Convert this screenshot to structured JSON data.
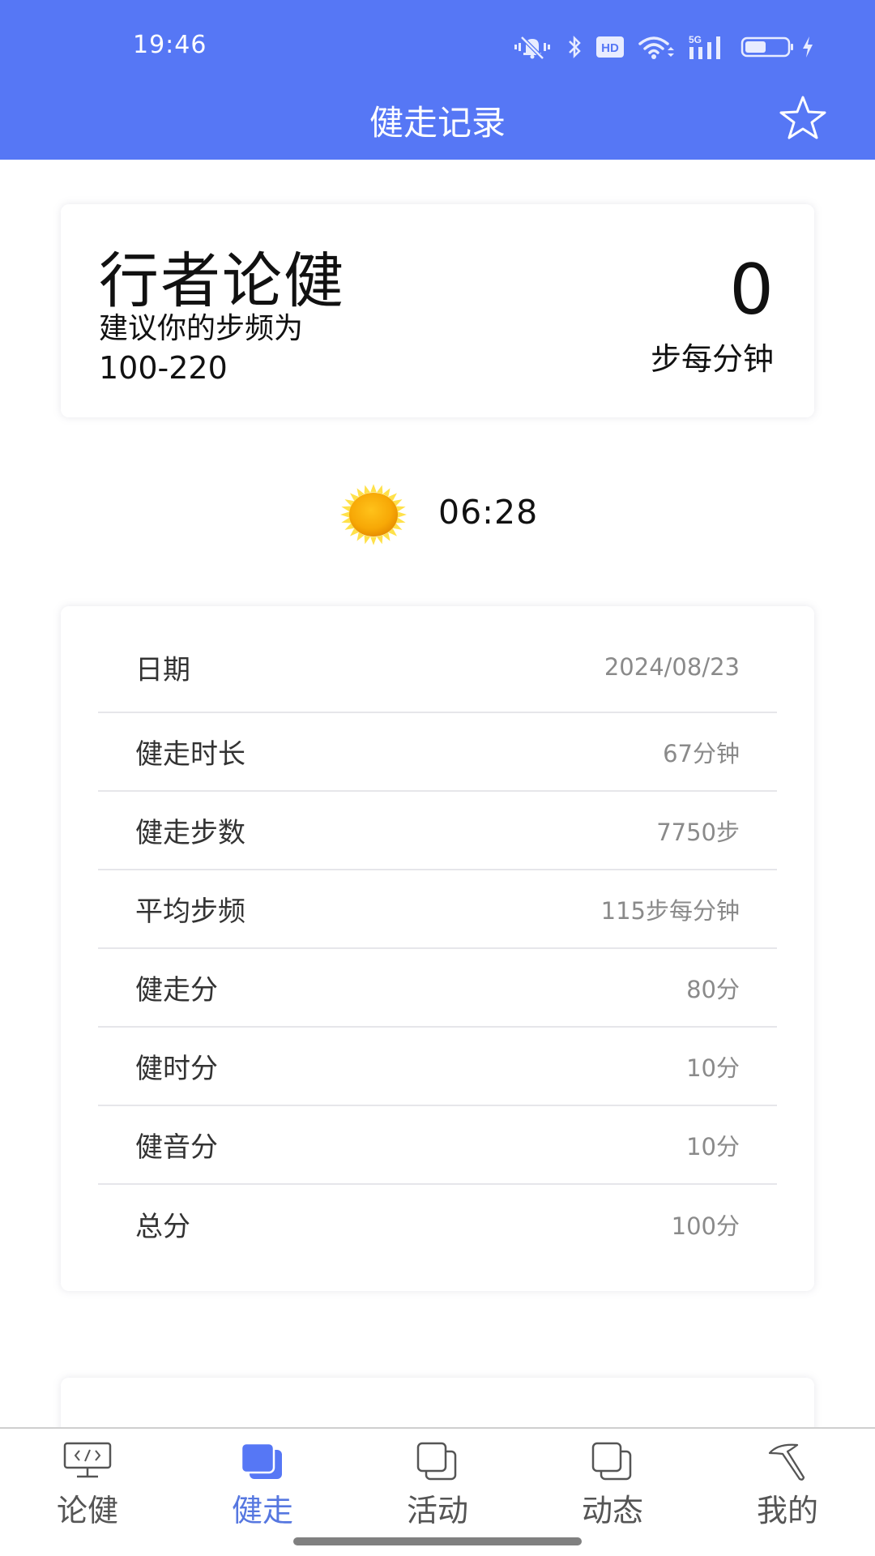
{
  "status_bar": {
    "time": "19:46",
    "icons": [
      "mute-vibrate-icon",
      "bluetooth-icon",
      "hd-icon",
      "wifi-icon",
      "5g-signal-icon",
      "battery-icon",
      "charging-icon"
    ],
    "hd_label": "HD",
    "network_label": "5G",
    "battery_level_percent": 50
  },
  "header": {
    "title": "健走记录",
    "favorite_icon": "star-outline-icon",
    "accent_color": "#5677f5"
  },
  "summary_card": {
    "brand": "行者论健",
    "hint": "建议你的步频为",
    "range": "100-220",
    "cadence_value": "0",
    "cadence_unit": "步每分钟"
  },
  "sunrise": {
    "icon": "sun-icon",
    "time": "06:28"
  },
  "details": {
    "rows": [
      {
        "label": "日期",
        "value": "2024/08/23"
      },
      {
        "label": "健走时长",
        "value": "67分钟"
      },
      {
        "label": "健走步数",
        "value": "7750步"
      },
      {
        "label": "平均步频",
        "value": "115步每分钟"
      },
      {
        "label": "健走分",
        "value": "80分"
      },
      {
        "label": "健时分",
        "value": "10分"
      },
      {
        "label": "健音分",
        "value": "10分"
      },
      {
        "label": "总分",
        "value": "100分"
      }
    ]
  },
  "bottom_nav": {
    "active_index": 1,
    "active_color": "#5677e0",
    "tabs": [
      {
        "label": "论健",
        "icon": "monitor-code-icon"
      },
      {
        "label": "健走",
        "icon": "cards-stack-icon"
      },
      {
        "label": "活动",
        "icon": "cards-stack-outline-icon"
      },
      {
        "label": "动态",
        "icon": "cards-stack-outline-icon"
      },
      {
        "label": "我的",
        "icon": "hammer-icon"
      }
    ]
  }
}
